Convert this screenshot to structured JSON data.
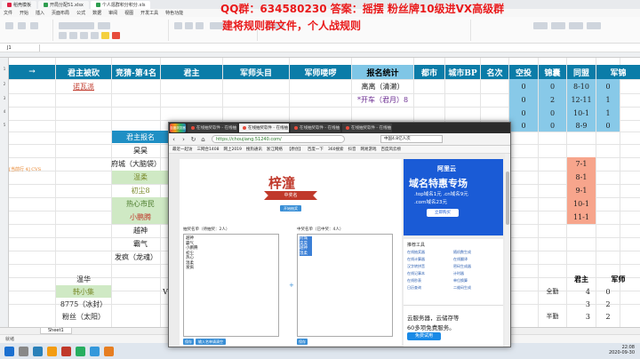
{
  "excel_tabs": [
    {
      "label": "稻壳模板"
    },
    {
      "label": "开局分配51.xlsx"
    },
    {
      "label": "个人逛群积分积分.xls"
    }
  ],
  "menu": [
    "文件",
    "开始",
    "插入",
    "页面布局",
    "公式",
    "数据",
    "审阅",
    "视图",
    "开发工具",
    "特色功能"
  ],
  "name_box": "J1",
  "overlay": {
    "qq": "QQ群：634580230 答案：摇摆 粉丝牌10级进VX高级群",
    "rule": "建将规则群文件，个人战规则"
  },
  "sheet": {
    "headers": [
      "→",
      "君主被砍",
      "竞猜-第4名",
      "君主",
      "军师头目",
      "军师喽啰",
      "报名统计",
      "都市",
      "城市BP",
      "名次",
      "空投",
      "锦囊",
      "同盟",
      "军锦"
    ],
    "row2": {
      "b": "诺瓦派",
      "g": "离离（清濑）",
      "k": "0",
      "l": "0",
      "m": "8-10",
      "n": "0"
    },
    "row3": {
      "g": "*开车（君月）8",
      "k": "0",
      "l": "2",
      "m": "12-11",
      "n": "1"
    },
    "row4": {
      "k": "0",
      "l": "0",
      "m": "10-1",
      "n": "1"
    },
    "row5": {
      "k": "0",
      "l": "0",
      "m": "8-9",
      "n": "0"
    },
    "signup_label": "君主报名",
    "names": [
      "昊昊",
      "府城（大脑袋）",
      "温柔",
      "初尘8",
      "热心市民",
      "小鹏腾",
      "越神",
      "霸气",
      "发疯（龙魂）"
    ],
    "right_col": [
      "7-1",
      "8-1",
      "9-1",
      "10-1",
      "11-1"
    ],
    "annotation": "[当前行 4]  CVS",
    "bottom_names": [
      "温华",
      "韩小集",
      "8775（冰封）",
      "粉丝（太阳）"
    ],
    "bottom_right": [
      {
        "a": "君主",
        "b": "军师"
      },
      {
        "a": "全勤",
        "b": "4",
        "c": "0"
      },
      {
        "a": "",
        "b": "3",
        "c": "2"
      },
      {
        "a": "半勤",
        "b": "3",
        "c": "2"
      }
    ],
    "bottom_v": "V"
  },
  "sheet_tab": "Sheet1",
  "status": "就绪",
  "clock": {
    "time": "22:08",
    "date": "2020-09-30"
  },
  "browser": {
    "tabs": [
      "在线抽奖软件 - 在线抽",
      "在线抽奖软件 - 在线抽",
      "在线抽奖软件 - 在线抽",
      "在线抽奖软件 - 在线抽"
    ],
    "logo": "百度浏览器",
    "url": "https://choujiang.51240.com/",
    "search": "中国4.8亿人次",
    "favorites": [
      "最近一起访",
      "三网合1408",
      "网上2019",
      "搜狗通讯",
      "浙江网络",
      "【原创】",
      "百度一下",
      "360搜索",
      "抖音",
      "网易游戏",
      "百度风云榜"
    ],
    "title": "梓潼",
    "ribbon": "中奖名",
    "start_btn": "开始抽奖",
    "left_label": "抽奖名单（待抽奖：2人）",
    "right_label": "中奖名单（已中奖：4人）",
    "left_list": [
      "越神",
      "霸气",
      "小鹏腾",
      "初尘",
      "热心",
      "温柔",
      "发疯"
    ],
    "right_list": [
      "府城",
      "昊昊",
      "越神",
      "温柔"
    ],
    "left_btn1": "保存",
    "left_btn2": "输入名单请清空",
    "right_btn": "保存",
    "ad1": {
      "brand": "阿里云",
      "headline": "域名特惠专场",
      "l2": ".top域名1元 .cn域名9元",
      "l3": ".com域名23元",
      "cta": "立即购买"
    },
    "tools_title": "推荐工具",
    "tools": [
      "在线抽奖器",
      "随机数生成",
      "在线计算器",
      "在线翻译",
      "汉字转拼音",
      "密码生成器",
      "在线记事本",
      "计时器",
      "在线秒表",
      "单位换算",
      "日历查询",
      "二维码生成"
    ],
    "ad2": {
      "t1": "云服务器，云储存等",
      "t2": "60多项免费服务。",
      "btn": "免费试用"
    }
  }
}
